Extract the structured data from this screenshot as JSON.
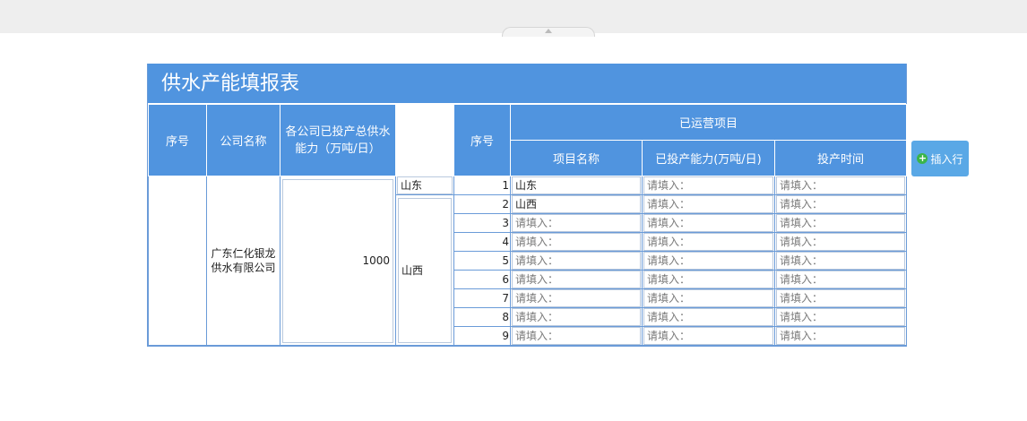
{
  "form": {
    "title": "供水产能填报表",
    "headers": {
      "seq": "序号",
      "company": "公司名称",
      "capacity": "各公司已投产总供水能力（万吨/日）",
      "seq2": "序号",
      "operating_group": "已运营项目",
      "project_name": "项目名称",
      "project_capacity": "已投产能力(万吨/日)",
      "project_time": "投产时间"
    },
    "company_name": "广东仁化银龙供水有限公司",
    "total_capacity": "1000",
    "regions": [
      "山东",
      "山西"
    ],
    "rows": [
      {
        "no": "1",
        "name": "山东"
      },
      {
        "no": "2",
        "name": "山西"
      },
      {
        "no": "3",
        "name": ""
      },
      {
        "no": "4",
        "name": ""
      },
      {
        "no": "5",
        "name": ""
      },
      {
        "no": "6",
        "name": ""
      },
      {
        "no": "7",
        "name": ""
      },
      {
        "no": "8",
        "name": ""
      },
      {
        "no": "9",
        "name": ""
      }
    ],
    "placeholder": "请填入："
  },
  "actions": {
    "insert_row": "插入行"
  },
  "colors": {
    "header_bg": "#5094df",
    "border": "#6a9bd8",
    "button_bg": "#5aa8e6",
    "plus_green": "#3bb54a"
  }
}
